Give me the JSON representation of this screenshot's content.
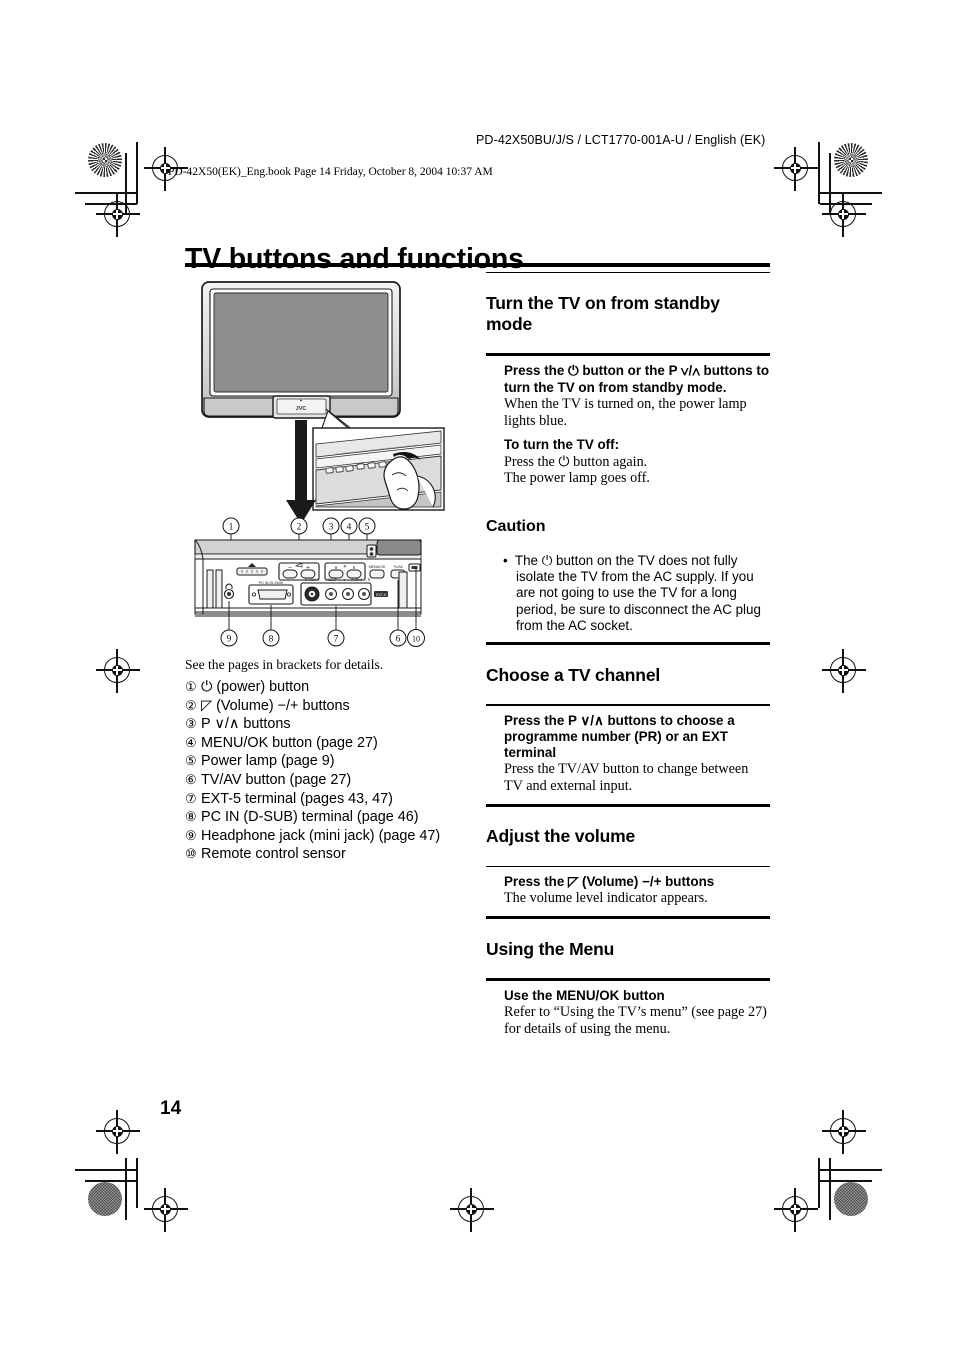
{
  "header": {
    "doc_code": "PD-42X50BU/J/S / LCT1770-001A-U / English (EK)",
    "file_line": "PD-42X50(EK)_Eng.book  Page 14  Friday, October 8, 2004  10:37 AM"
  },
  "page_title": "TV buttons and functions",
  "page_number": "14",
  "figure": {
    "caption_lead": "See the pages in brackets for details.",
    "callouts": [
      "1",
      "2",
      "3",
      "4",
      "5",
      "6",
      "7",
      "8",
      "9",
      "10"
    ],
    "items": [
      {
        "num": "①",
        "text": "⏻ (power) button"
      },
      {
        "num": "②",
        "text": "◸ (Volume) −/+ buttons"
      },
      {
        "num": "③",
        "text": "P ∨/∧ buttons"
      },
      {
        "num": "④",
        "text": "MENU/OK button (page 27)"
      },
      {
        "num": "⑤",
        "text": "Power lamp (page 9)"
      },
      {
        "num": "⑥",
        "text": "TV/AV button (page 27)"
      },
      {
        "num": "⑦",
        "text": "EXT-5 terminal (pages 43, 47)"
      },
      {
        "num": "⑧",
        "text": "PC IN (D-SUB) terminal (page 46)"
      },
      {
        "num": "⑨",
        "text": "Headphone jack (mini jack) (page 47)"
      },
      {
        "num": "⑩",
        "text": "Remote control sensor"
      }
    ],
    "brand_logo": "JVC"
  },
  "sections": [
    {
      "id": "standby",
      "heading": "Turn the TV on from standby mode",
      "blocks": [
        {
          "kind": "bold",
          "text": "Press the ⏻ button or the P ∨/∧ buttons to turn the TV on from standby mode."
        },
        {
          "kind": "plain",
          "text": "When the TV is turned on, the power lamp lights blue."
        },
        {
          "kind": "bold",
          "text": "To turn the TV off:"
        },
        {
          "kind": "plain",
          "text": "Press the ⏻ button again."
        },
        {
          "kind": "plain",
          "text": "The power lamp goes off."
        }
      ],
      "caution": {
        "heading": "Caution",
        "bullet": "•",
        "text": "The ⏻ button on the TV does not fully isolate the TV from the AC supply. If you are not going to use the TV for a long period, be sure to disconnect the AC plug from the AC socket."
      }
    },
    {
      "id": "channel",
      "heading": "Choose a TV channel",
      "blocks": [
        {
          "kind": "bold",
          "text": "Press the P ∨/∧ buttons to choose a programme number (PR) or an EXT terminal"
        },
        {
          "kind": "plain",
          "text": "Press the TV/AV button to change between TV and external input."
        }
      ]
    },
    {
      "id": "volume",
      "heading": "Adjust the volume",
      "blocks": [
        {
          "kind": "bold",
          "text": "Press the ◸ (Volume) −/+ buttons"
        },
        {
          "kind": "plain",
          "text": "The volume level indicator appears."
        }
      ]
    },
    {
      "id": "menu",
      "heading": "Using the Menu",
      "blocks": [
        {
          "kind": "bold",
          "text": "Use the MENU/OK button"
        },
        {
          "kind": "plain",
          "text": "Refer to “Using the TV’s menu” (see page 27) for details of using the menu."
        }
      ]
    }
  ],
  "colors": {
    "ink": "#000000",
    "screen_gray": "#8e8e8e",
    "bezel_gray": "#d4d4d4",
    "panel_gray": "#c8c8c8",
    "light_gray": "#e9e9e9"
  }
}
